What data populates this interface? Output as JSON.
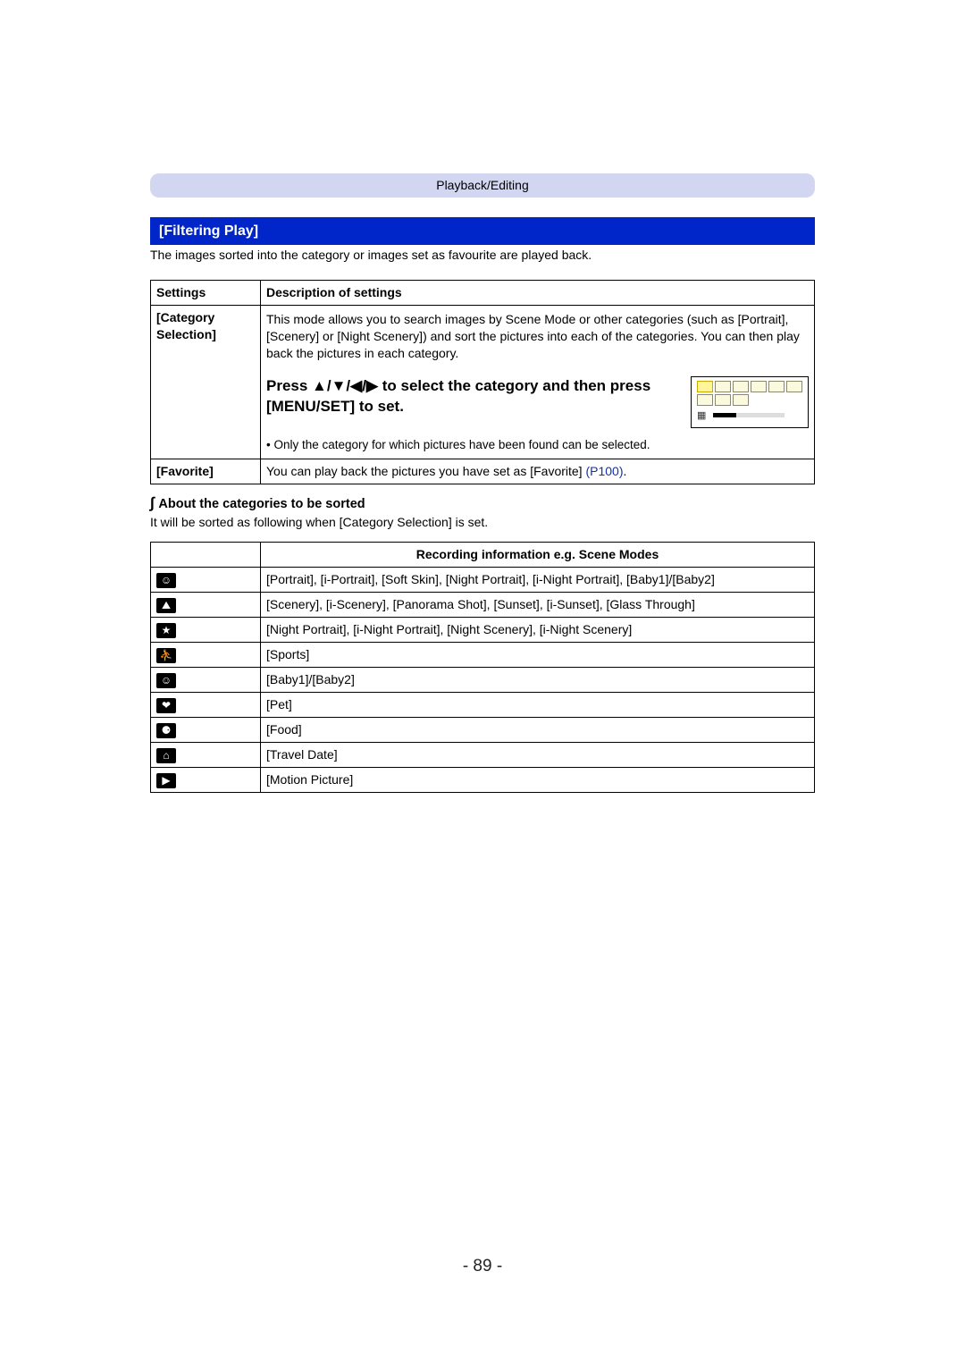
{
  "breadcrumb": "Playback/Editing",
  "section_title": "[Filtering Play]",
  "intro": "The images sorted into the category or images set as favourite are played back.",
  "settings_table": {
    "head_settings": "Settings",
    "head_description": "Description of settings",
    "category_selection": {
      "label": "[Category Selection]",
      "description": "This mode allows you to search images by Scene Mode or other categories (such as [Portrait], [Scenery] or [Night Scenery]) and sort the pictures into each of the categories. You can then play back the pictures in each category.",
      "instruction": "Press ▲/▼/◀/▶ to select the category and then press [MENU/SET] to set.",
      "note": "Only the category for which pictures have been found can be selected."
    },
    "favorite": {
      "label": "[Favorite]",
      "description_prefix": "You can play back the pictures you have set as [Favorite] ",
      "link_text": "(P100)",
      "description_suffix": "."
    }
  },
  "about": {
    "heading": "About the categories to be sorted",
    "desc": "It will be sorted as following when [Category Selection] is set."
  },
  "categories_table": {
    "head": "Recording information e.g. Scene Modes",
    "rows": [
      {
        "icon": "portrait-icon",
        "glyph": "☺",
        "text": "[Portrait], [i-Portrait], [Soft Skin], [Night Portrait], [i-Night Portrait], [Baby1]/[Baby2]"
      },
      {
        "icon": "scenery-icon",
        "glyph": "⛰",
        "text": "[Scenery], [i-Scenery], [Panorama Shot], [Sunset], [i-Sunset], [Glass Through]"
      },
      {
        "icon": "night-icon",
        "glyph": "★",
        "text": "[Night Portrait], [i-Night Portrait], [Night Scenery], [i-Night Scenery]"
      },
      {
        "icon": "sports-icon",
        "glyph": "⛹",
        "text": "[Sports]"
      },
      {
        "icon": "baby-icon",
        "glyph": "☺",
        "text": "[Baby1]/[Baby2]"
      },
      {
        "icon": "pet-icon",
        "glyph": "❤",
        "text": "[Pet]"
      },
      {
        "icon": "food-icon",
        "glyph": "⚈",
        "text": "[Food]"
      },
      {
        "icon": "travel-date-icon",
        "glyph": "⌂",
        "text": "[Travel Date]"
      },
      {
        "icon": "motion-picture-icon",
        "glyph": "▶",
        "text": "[Motion Picture]"
      }
    ]
  },
  "page_number": "- 89 -"
}
